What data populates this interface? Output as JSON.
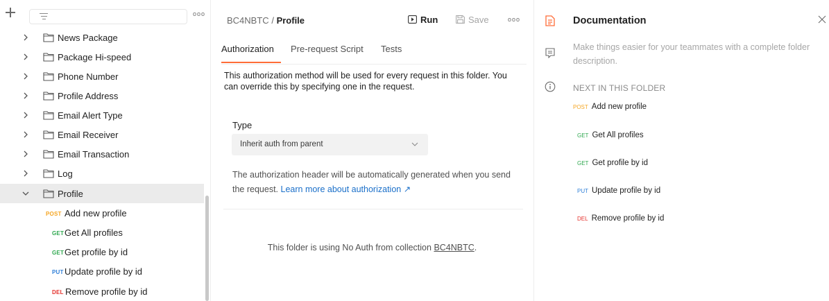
{
  "colors": {
    "post": "#f5a623",
    "get": "#2fa84f",
    "put": "#2f7fd8",
    "del": "#e5322d",
    "accent": "#ff6c37",
    "link": "#1a6fc9"
  },
  "sidebar": {
    "more_label": "ooo",
    "folders": [
      {
        "label": "News Package"
      },
      {
        "label": "Package Hi-speed"
      },
      {
        "label": "Phone Number"
      },
      {
        "label": "Profile Address"
      },
      {
        "label": "Email Alert Type"
      },
      {
        "label": "Email Receiver"
      },
      {
        "label": "Email Transaction"
      },
      {
        "label": "Log"
      },
      {
        "label": "Profile"
      }
    ],
    "requests": [
      {
        "method": "POST",
        "label": "Add new profile"
      },
      {
        "method": "GET",
        "label": "Get All profiles"
      },
      {
        "method": "GET",
        "label": "Get profile by id"
      },
      {
        "method": "PUT",
        "label": "Update profile by id"
      },
      {
        "method": "DEL",
        "label": "Remove profile by id"
      }
    ]
  },
  "header": {
    "collection": "BC4NBTC",
    "separator": "/",
    "folder": "Profile",
    "run_label": "Run",
    "save_label": "Save",
    "more_label": "ooo"
  },
  "tabs": [
    {
      "label": "Authorization"
    },
    {
      "label": "Pre-request Script"
    },
    {
      "label": "Tests"
    }
  ],
  "auth": {
    "description": "This authorization method will be used for every request in this folder. You can override this by specifying one in the request.",
    "type_label": "Type",
    "type_value": "Inherit auth from parent",
    "note": "The authorization header will be automatically generated when you send the request.",
    "learn_more": "Learn more about authorization ↗",
    "folder_note": "This folder is using No Auth from collection",
    "folder_note_link": "BC4NBTC",
    "folder_note_end": "."
  },
  "docs": {
    "title": "Documentation",
    "description": "Make things easier for your teammates with a complete folder description.",
    "next_heading": "NEXT IN THIS FOLDER",
    "items": [
      {
        "method": "POST",
        "label": "Add new profile"
      },
      {
        "method": "GET",
        "label": "Get All profiles"
      },
      {
        "method": "GET",
        "label": "Get profile by id"
      },
      {
        "method": "PUT",
        "label": "Update profile by id"
      },
      {
        "method": "DEL",
        "label": "Remove profile by id"
      }
    ]
  },
  "icons": {
    "new": "plus-icon",
    "filter": "filter-icon",
    "run": "play-icon",
    "save": "save-icon",
    "documentation": "document-icon",
    "comments": "comment-icon",
    "info": "info-icon",
    "close": "close-icon"
  }
}
